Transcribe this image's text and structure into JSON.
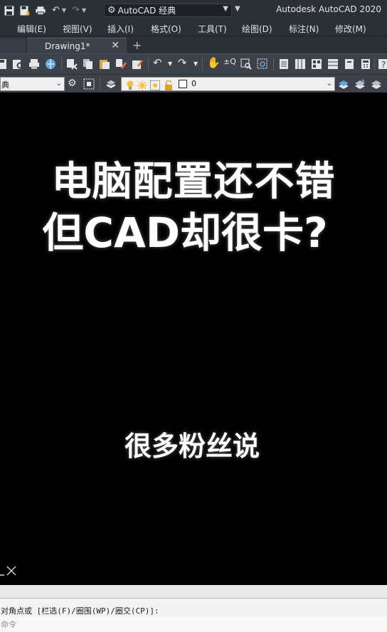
{
  "titlebar": {
    "workspace": "AutoCAD 经典",
    "app_title": "Autodesk AutoCAD 2020"
  },
  "menu": [
    "编辑(E)",
    "视图(V)",
    "插入(I)",
    "格式(O)",
    "工具(T)",
    "绘图(D)",
    "标注(N)",
    "修改(M)"
  ],
  "tabs": {
    "document": "Drawing1*",
    "close": "✕",
    "new": "+"
  },
  "toolbar2": {
    "text_style": "典",
    "layer_name": "0"
  },
  "overlay": {
    "line1": "电脑配置还不错",
    "line2": "但CAD却很卡?",
    "line3": "很多粉丝说"
  },
  "command": {
    "prompt": "对角点或 [栏选(F)/圈围(WP)/圈交(CP)]:",
    "input_placeholder": "命令"
  },
  "colors": {
    "chrome_dark": "#2b2f36",
    "toolbar": "#3c414a",
    "canvas": "#000000"
  }
}
